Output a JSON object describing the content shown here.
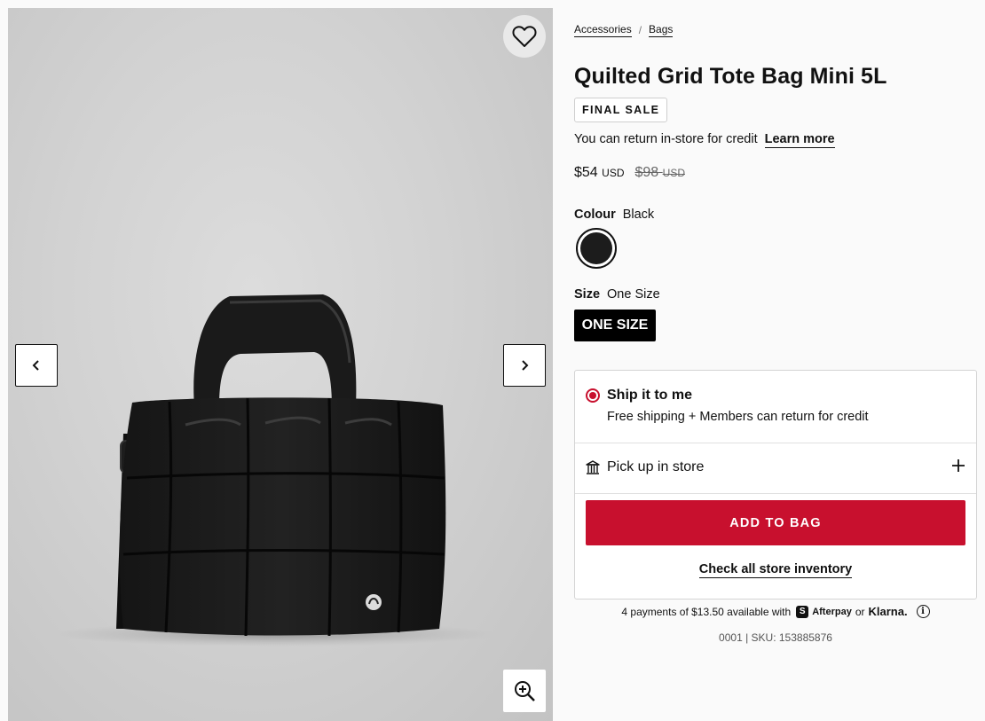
{
  "gallery": {
    "image_alt": "Black quilted grid tote bag",
    "wishlist_icon": "heart-icon",
    "prev_icon": "chevron-left-icon",
    "next_icon": "chevron-right-icon",
    "zoom_icon": "zoom-in-icon"
  },
  "breadcrumb": {
    "items": [
      "Accessories",
      "Bags"
    ],
    "separator": "/"
  },
  "product": {
    "title": "Quilted Grid Tote Bag Mini 5L",
    "badge": "FINAL SALE",
    "return_note": "You can return in-store for credit",
    "learn_more": "Learn more",
    "price": "$54",
    "price_currency": "USD",
    "original_price": "$98",
    "original_currency": "USD"
  },
  "colour": {
    "label": "Colour",
    "value": "Black",
    "swatch_color": "#1c1c1c"
  },
  "size": {
    "label": "Size",
    "value": "One Size",
    "option": "ONE SIZE"
  },
  "delivery": {
    "ship_title": "Ship it to me",
    "ship_subtitle": "Free shipping + Members can return for credit",
    "pickup_label": "Pick up in store",
    "add_to_bag": "ADD TO BAG",
    "check_inventory": "Check all store inventory"
  },
  "payments": {
    "text": "4 payments of $13.50 available with",
    "afterpay_badge": "S",
    "afterpay": "Afterpay",
    "or": "or",
    "klarna": "Klarna.",
    "info": "i"
  },
  "sku": "0001 | SKU: 153885876",
  "colors": {
    "accent": "#c8102e",
    "text": "#111111",
    "background": "#fafafa"
  }
}
